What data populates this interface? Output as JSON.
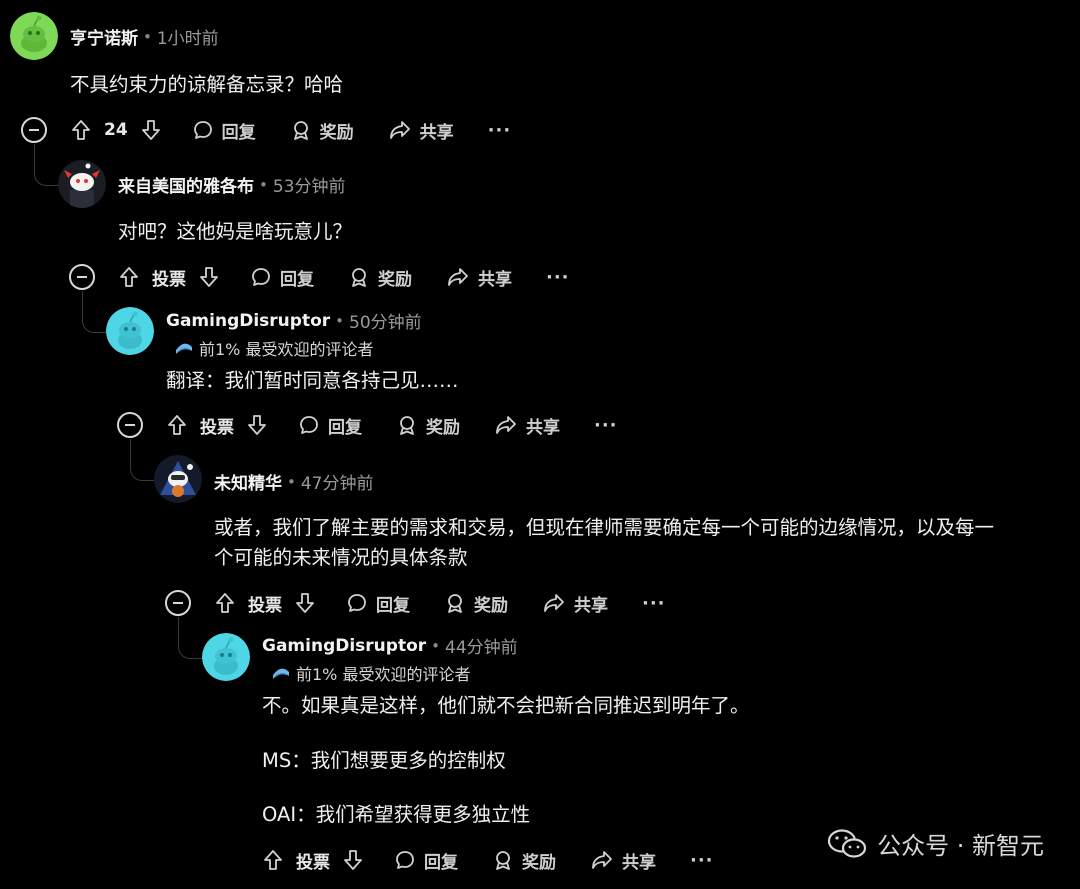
{
  "comments": [
    {
      "author": "亨宁诺斯",
      "time": "1小时前",
      "body": "不具约束力的谅解备忘录？哈哈",
      "vote_count": "24",
      "actions": {
        "reply": "回复",
        "award": "奖励",
        "share": "共享",
        "more": "···"
      }
    },
    {
      "author": "来自美国的雅各布",
      "time": "53分钟前",
      "body": "对吧？这他妈是啥玩意儿？",
      "vote_label": "投票",
      "actions": {
        "reply": "回复",
        "award": "奖励",
        "share": "共享",
        "more": "···"
      }
    },
    {
      "author": "GamingDisruptor",
      "time": "50分钟前",
      "flair": "前1% 最受欢迎的评论者",
      "body": "翻译：我们暂时同意各持己见……",
      "vote_label": "投票",
      "actions": {
        "reply": "回复",
        "award": "奖励",
        "share": "共享",
        "more": "···"
      }
    },
    {
      "author": "未知精华",
      "time": "47分钟前",
      "body_lines": [
        "或者，我们了解主要的需求和交易，但现在律师需要确定每一个可能的边缘情况，以及每一",
        "个可能的未来情况的具体条款"
      ],
      "vote_label": "投票",
      "actions": {
        "reply": "回复",
        "award": "奖励",
        "share": "共享",
        "more": "···"
      }
    },
    {
      "author": "GamingDisruptor",
      "time": "44分钟前",
      "flair": "前1% 最受欢迎的评论者",
      "body_paragraphs": [
        "不。如果真是这样，他们就不会把新合同推迟到明年了。",
        "MS：我们想要更多的控制权",
        "OAI：我们希望获得更多独立性"
      ],
      "vote_label": "投票",
      "actions": {
        "reply": "回复",
        "award": "奖励",
        "share": "共享",
        "more": "···"
      }
    }
  ],
  "separator_dot": "•",
  "watermark": "公众号 · 新智元",
  "colors": {
    "background": "#000000",
    "avatar_green": "#7ed957",
    "avatar_cyan": "#4fd6e6",
    "text": "#f0f0f0",
    "muted": "#9a9a9a"
  }
}
